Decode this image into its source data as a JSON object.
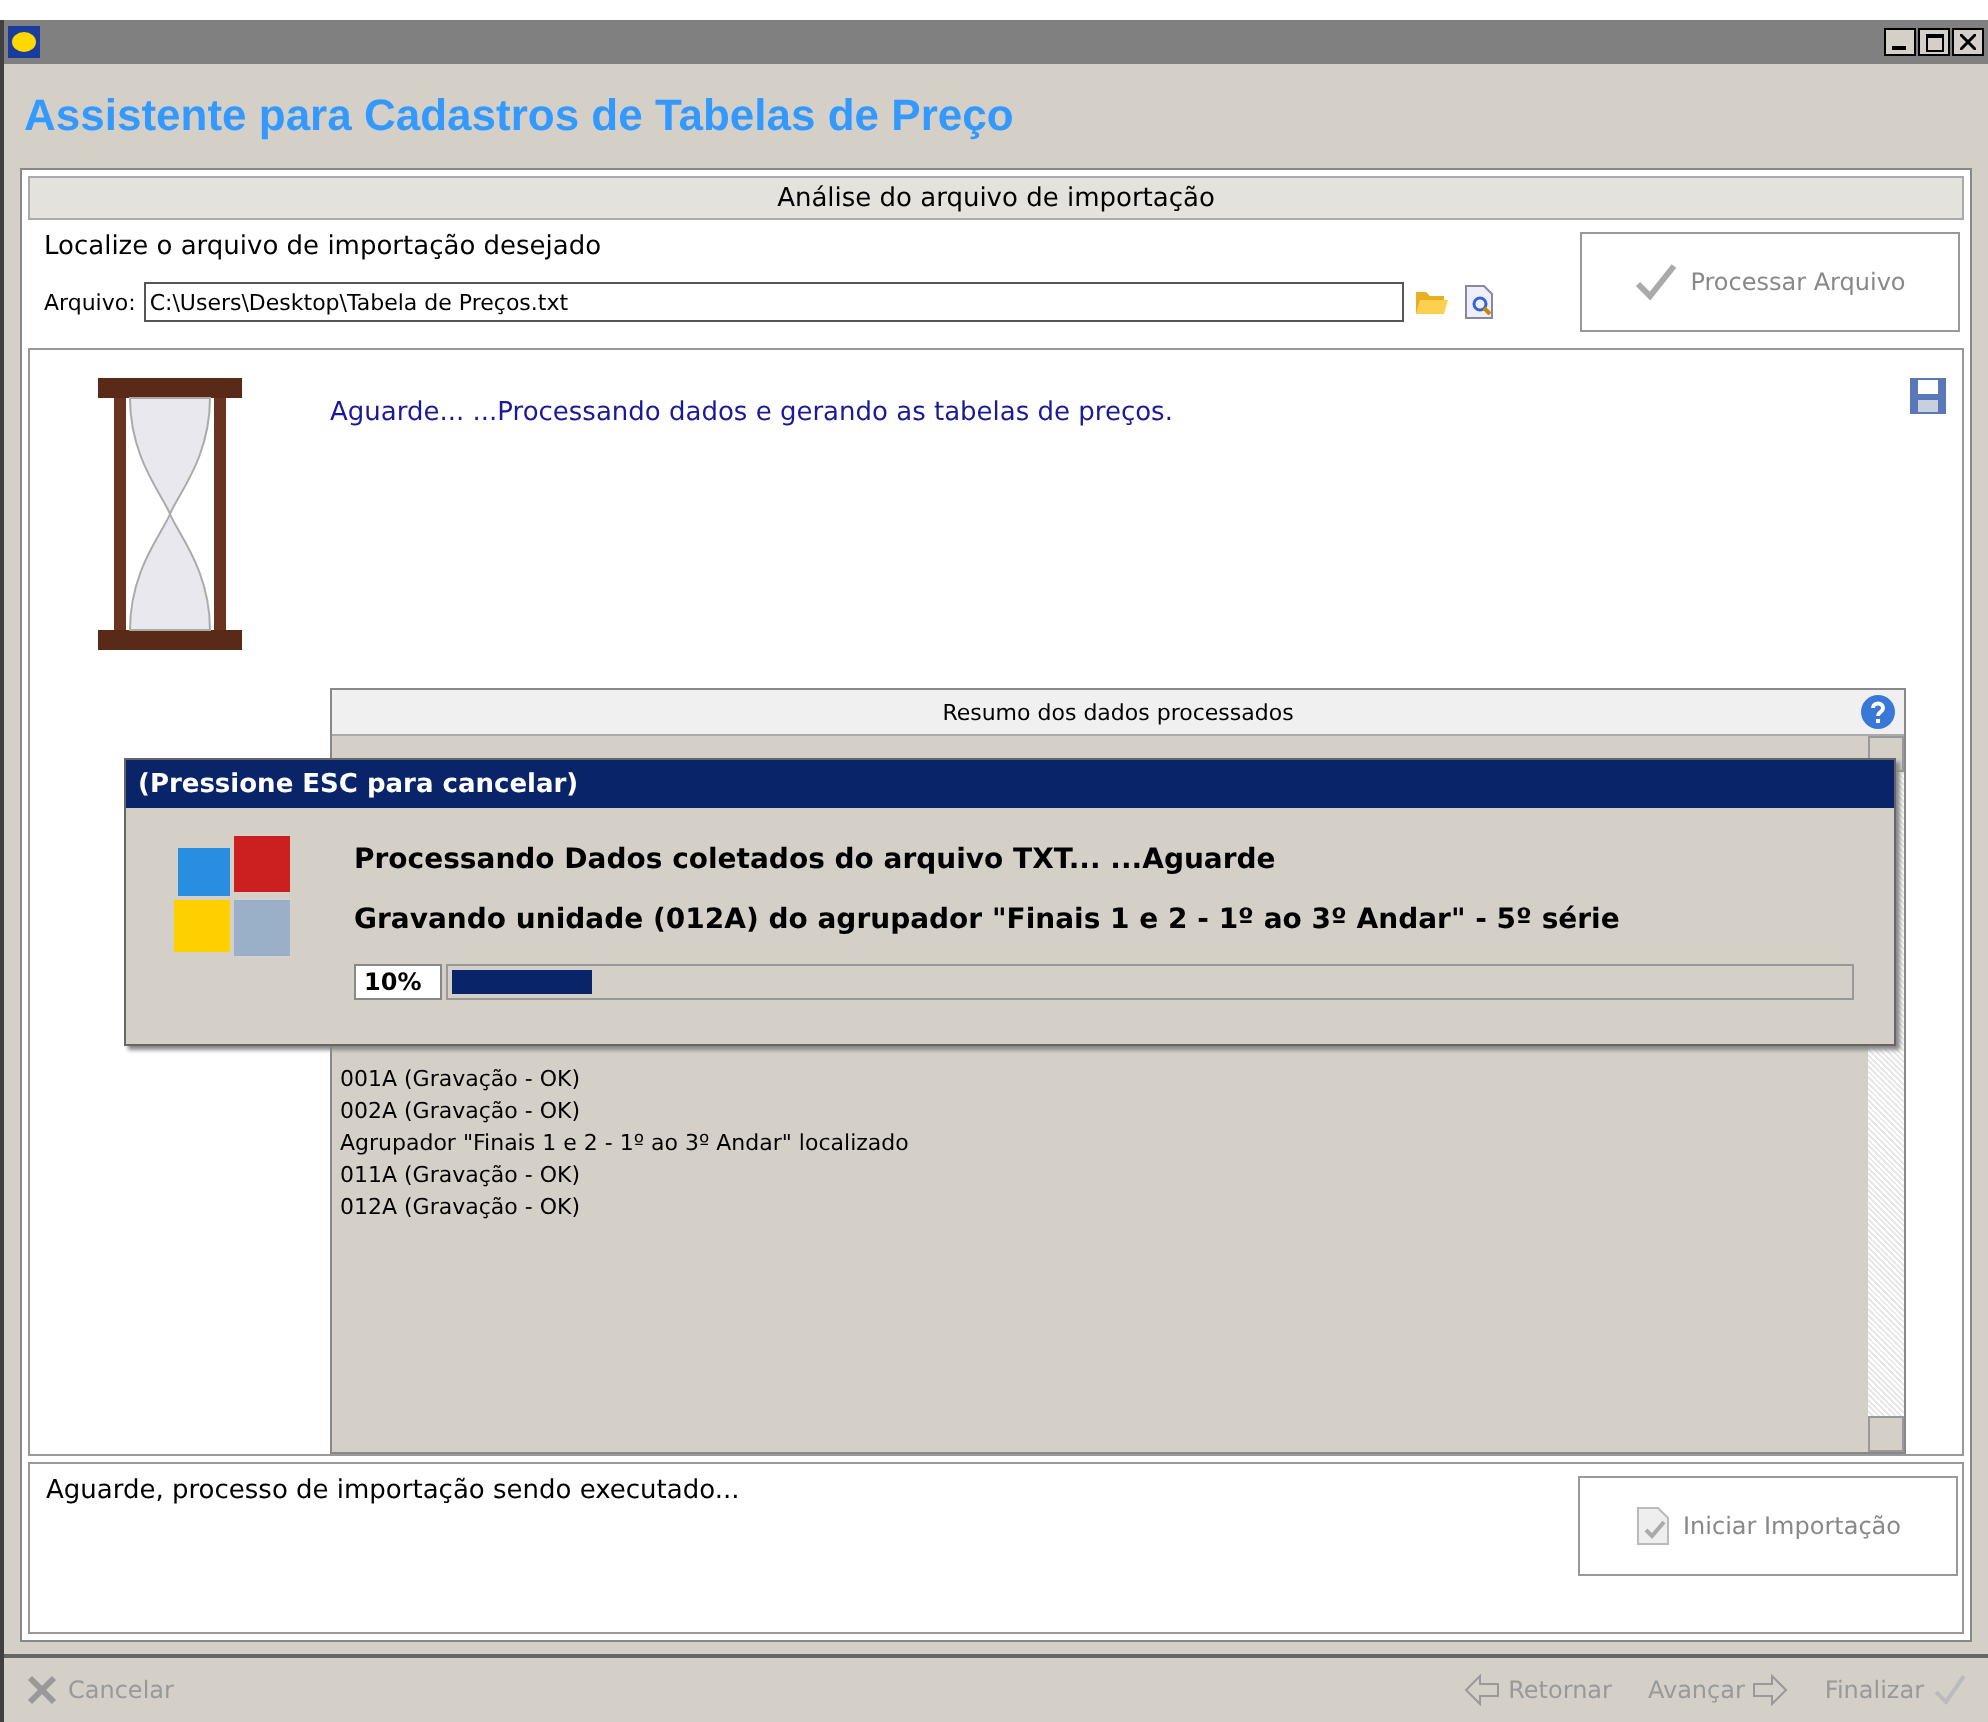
{
  "window": {
    "title": "Assistente para Cadastros de Tabelas de Preço"
  },
  "section_header": "Análise do arquivo de importação",
  "locate_label": "Localize o arquivo de importação desejado",
  "file_field": {
    "label": "Arquivo:",
    "value": "C:\\Users\\Desktop\\Tabela de Preços.txt"
  },
  "process_button": {
    "label": "Processar Arquivo",
    "disabled": true
  },
  "status_message": "Aguarde...   ...Processando dados e gerando as tabelas de preços.",
  "summary": {
    "title": "Resumo dos dados processados",
    "lines": [
      "001A (Gravação - OK)",
      "002A (Gravação - OK)",
      "Agrupador \"Finais 1 e 2 - 1º ao 3º Andar\" localizado",
      "011A (Gravação - OK)",
      "012A (Gravação - OK)"
    ]
  },
  "progress_dialog": {
    "title": "(Pressione ESC para cancelar)",
    "message": "Processando Dados coletados do arquivo TXT...   ...Aguarde",
    "detail": "Gravando unidade (012A) do agrupador \"Finais 1 e 2 - 1º ao 3º Andar\" - 5º série",
    "percent": "10%",
    "level": 0.1
  },
  "bottom_message": "Aguarde, processo de importação sendo executado...",
  "start_button": {
    "label": "Iniciar Importação",
    "disabled": true
  },
  "footer_buttons": [
    {
      "kind": "cancel",
      "label": "Cancelar",
      "disabled": true
    },
    {
      "kind": "back",
      "label": "Retornar",
      "disabled": true
    },
    {
      "kind": "next",
      "label": "Avançar",
      "disabled": true
    },
    {
      "kind": "finish",
      "label": "Finalizar",
      "disabled": true
    }
  ]
}
